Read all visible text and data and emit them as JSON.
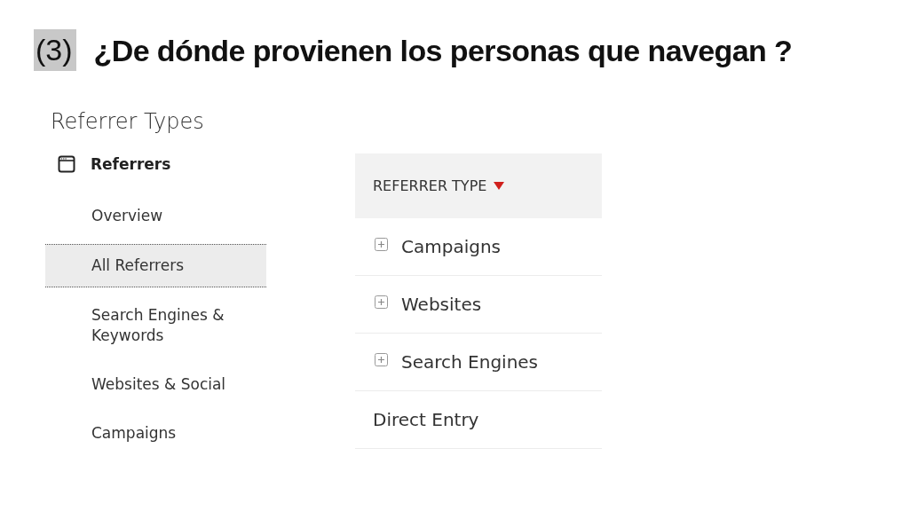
{
  "slide": {
    "number": "(3)",
    "title": "¿De dónde provienen los personas que navegan ?"
  },
  "page_heading": "Referrer Types",
  "sidebar": {
    "section": "Referrers",
    "items": [
      {
        "label": "Overview",
        "selected": false
      },
      {
        "label": "All Referrers",
        "selected": true
      },
      {
        "label": "Search Engines & Keywords",
        "selected": false
      },
      {
        "label": "Websites & Social",
        "selected": false
      },
      {
        "label": "Campaigns",
        "selected": false
      }
    ]
  },
  "table": {
    "columns": [
      {
        "label": "REFERRER TYPE",
        "sorted_descending": true
      }
    ],
    "rows": [
      {
        "label": "Campaigns",
        "expandable": true
      },
      {
        "label": "Websites",
        "expandable": true
      },
      {
        "label": "Search Engines",
        "expandable": true
      },
      {
        "label": "Direct Entry",
        "expandable": false
      }
    ]
  }
}
